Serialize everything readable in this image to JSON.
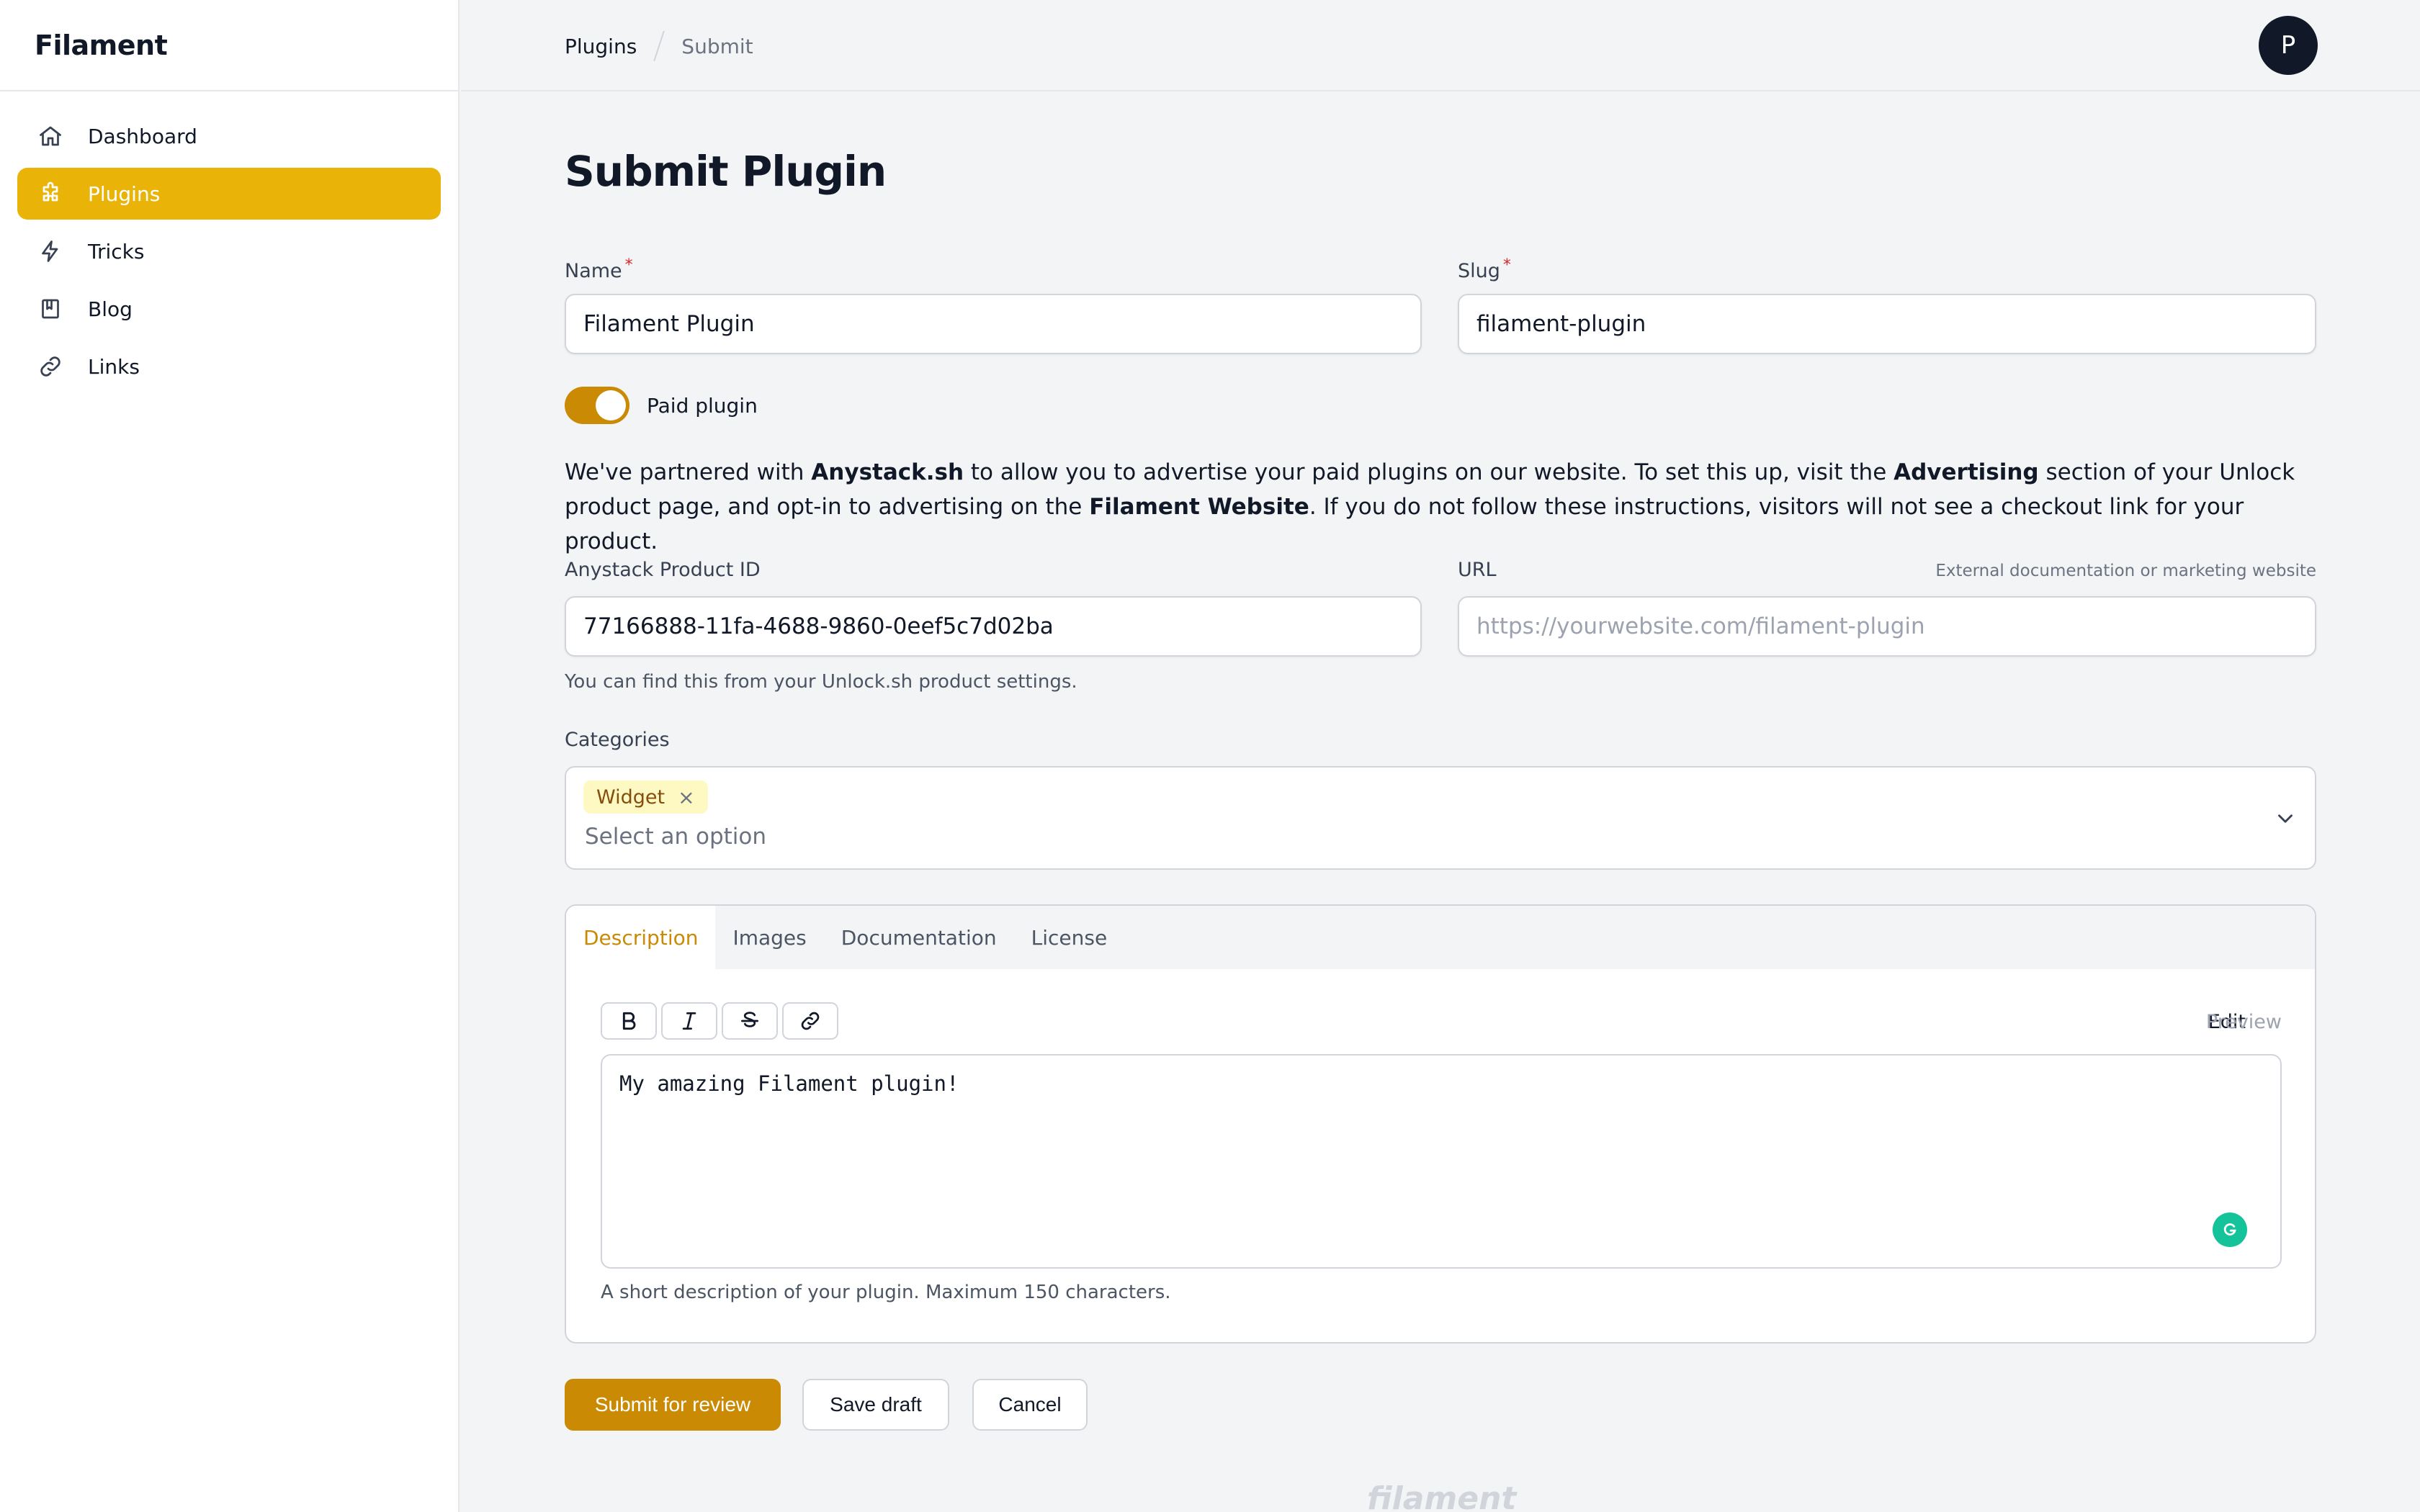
{
  "brand": "Filament",
  "sidebar": {
    "items": [
      {
        "label": "Dashboard",
        "icon": "home-icon"
      },
      {
        "label": "Plugins",
        "icon": "puzzle-icon",
        "active": true
      },
      {
        "label": "Tricks",
        "icon": "bolt-icon"
      },
      {
        "label": "Blog",
        "icon": "book-icon"
      },
      {
        "label": "Links",
        "icon": "link-icon"
      }
    ]
  },
  "breadcrumbs": [
    "Plugins",
    "Submit"
  ],
  "user": {
    "avatar_initial": "P"
  },
  "page": {
    "title": "Submit Plugin"
  },
  "form": {
    "name": {
      "label": "Name",
      "required_mark": "*",
      "value": "Filament Plugin"
    },
    "slug": {
      "label": "Slug",
      "required_mark": "*",
      "value": "filament-plugin"
    },
    "paid_toggle": {
      "label": "Paid plugin",
      "on": true
    },
    "notice": {
      "p1": "We've partnered with ",
      "b1": "Anystack.sh",
      "p2": " to allow you to advertise your paid plugins on our website. To set this up, visit the ",
      "b2": "Advertising",
      "p3": " section of your Unlock product page, and opt-in to advertising on the ",
      "b3": "Filament Website",
      "p4": ". If you do not follow these instructions, visitors will not see a checkout link for your product."
    },
    "anystack_id": {
      "label": "Anystack Product ID",
      "value": "77166888-11fa-4688-9860-0eef5c7d02ba",
      "hint": "You can find this from your Unlock.sh product settings."
    },
    "url": {
      "label": "URL",
      "hint": "External documentation or marketing website",
      "placeholder": "https://yourwebsite.com/filament-plugin"
    },
    "categories": {
      "label": "Categories",
      "selected": [
        "Widget"
      ],
      "remove_glyph": "×",
      "placeholder": "Select an option"
    },
    "tabs": [
      "Description",
      "Images",
      "Documentation",
      "License"
    ],
    "active_tab": "Description",
    "editor": {
      "mode_edit": "Edit",
      "mode_preview": "Preview",
      "content": "My amazing Filament plugin!",
      "hint": "A short description of your plugin. Maximum 150 characters."
    }
  },
  "actions": {
    "submit": "Submit for review",
    "draft": "Save draft",
    "cancel": "Cancel"
  },
  "footer": {
    "logo": "filament"
  },
  "colors": {
    "accent": "#eab308",
    "primary_button": "#ca8a04"
  }
}
